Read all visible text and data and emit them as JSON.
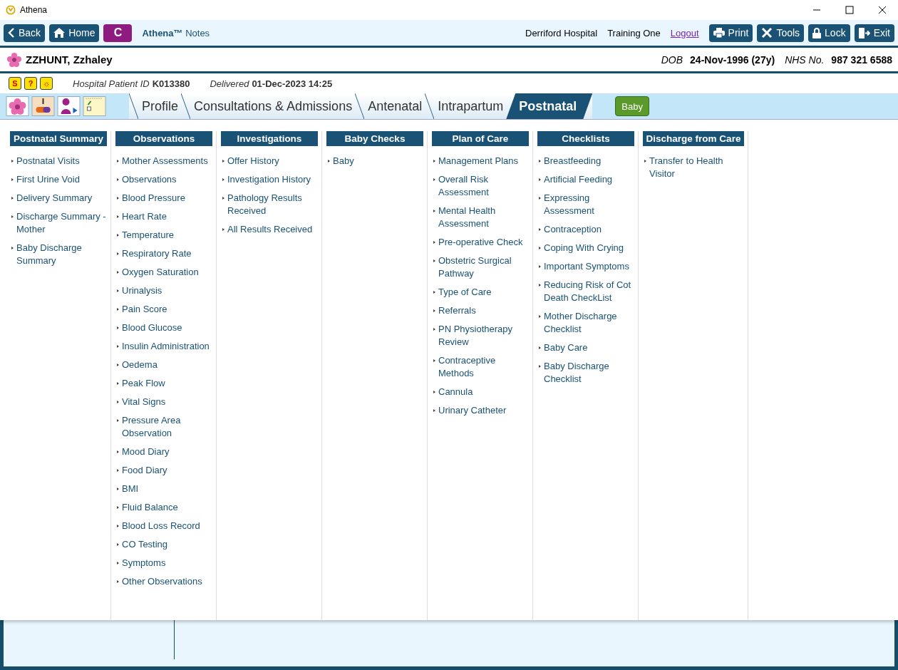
{
  "window": {
    "title": "Athena"
  },
  "toolbar": {
    "buttons": [
      {
        "kind": "back",
        "label": "Back"
      },
      {
        "kind": "home",
        "label": "Home"
      }
    ],
    "c_button": "C",
    "app_title": "**Athena™** Notes",
    "hospital": "Derriford Hospital",
    "user": "Training One",
    "logout": "Logout",
    "actions": [
      {
        "kind": "print",
        "label": "Print"
      },
      {
        "kind": "tools",
        "label": "Tools"
      },
      {
        "kind": "lock",
        "label": "Lock"
      },
      {
        "kind": "exit",
        "label": "Exit"
      }
    ]
  },
  "patient": {
    "name": "ZZHUNT, Zzhaley",
    "dob_label": "DOB",
    "dob": "24-Nov-1996 (27y)",
    "nhs_label": "NHS No.",
    "nhs": "987 321 6588"
  },
  "info": {
    "alerts": [
      "S",
      "?",
      "☼"
    ],
    "id_label": "Hospital Patient ID",
    "id": "K013380",
    "delivered_label": "Delivered",
    "delivered": "01-Dec-2023 14:25"
  },
  "tabs": [
    {
      "label": "Profile",
      "selected": false
    },
    {
      "label": "Consultations & Admissions",
      "selected": false
    },
    {
      "label": "Antenatal",
      "selected": false
    },
    {
      "label": "Intrapartum",
      "selected": false
    },
    {
      "label": "Postnatal",
      "selected": true
    }
  ],
  "baby_button": "Baby",
  "menu": [
    {
      "header": "Postnatal Summary",
      "items": [
        "Postnatal Visits",
        "First Urine Void",
        "Delivery Summary",
        "Discharge Summary - Mother",
        "Baby Discharge Summary"
      ]
    },
    {
      "header": "Observations",
      "items": [
        "Mother Assessments",
        "Observations",
        "Blood Pressure",
        "Heart Rate",
        "Temperature",
        "Respiratory Rate",
        "Oxygen Saturation",
        "Urinalysis",
        "Pain Score",
        "Blood Glucose",
        "Insulin Administration",
        "Oedema",
        "Peak Flow",
        "Vital Signs",
        "Pressure Area Observation",
        "Mood Diary",
        "Food Diary",
        "BMI",
        "Fluid Balance",
        "Blood Loss Record",
        "CO Testing",
        "Symptoms",
        "Other Observations"
      ]
    },
    {
      "header": "Investigations",
      "items": [
        "Offer History",
        "Investigation History",
        "Pathology Results Received",
        "All Results Received"
      ]
    },
    {
      "header": "Baby Checks",
      "items": [
        "Baby"
      ]
    },
    {
      "header": "Plan of Care",
      "items": [
        "Management Plans",
        "Overall Risk Assessment",
        "Mental Health Assessment",
        "Pre-operative Check",
        "Obstetric Surgical Pathway",
        "Type of Care",
        "Referrals",
        "PN Physiotherapy Review",
        "Contraceptive Methods",
        "Cannula",
        "Urinary Catheter"
      ]
    },
    {
      "header": "Checklists",
      "items": [
        "Breastfeeding",
        "Artificial Feeding",
        "Expressing Assessment",
        "Contraception",
        "Coping With Crying",
        "Important Symptoms",
        "Reducing Risk of Cot Death CheckList",
        "Mother Discharge Checklist",
        "Baby Care",
        "Baby Discharge Checklist"
      ]
    },
    {
      "header": "Discharge from Care",
      "items": [
        "Transfer to Health Visitor"
      ]
    }
  ]
}
